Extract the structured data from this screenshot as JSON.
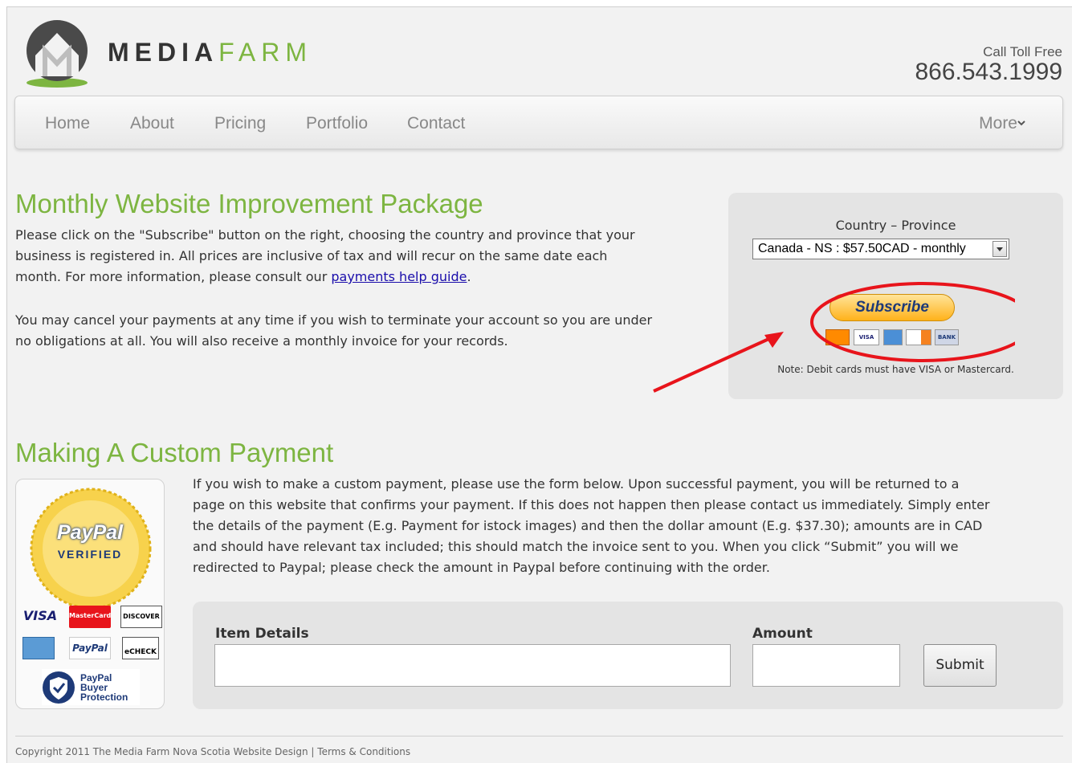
{
  "header": {
    "logo_letter": "M",
    "logo_media": "MEDIA",
    "logo_farm": "FARM",
    "call_label": "Call Toll Free",
    "phone": "866.543.1999"
  },
  "nav": {
    "items": [
      "Home",
      "About",
      "Pricing",
      "Portfolio",
      "Contact"
    ],
    "more": "More"
  },
  "monthly": {
    "title": "Monthly Website Improvement Package",
    "p1_a": "Please click on the \"Subscribe\" button on the right, choosing the country and province that your",
    "p1_b": "business is registered in. All prices are inclusive of tax and will recur on the same date each",
    "p1_c": "month. For more information, please consult our ",
    "p1_link": "payments help guide",
    "p1_end": ".",
    "p2_a": "You may cancel your payments at any time if you wish to terminate your account so you are under",
    "p2_b": "no obligations at all. You will also receive a monthly invoice for your records."
  },
  "subscribe": {
    "label": "Country – Province",
    "selected": "Canada - NS : $57.50CAD - monthly",
    "button": "Subscribe",
    "cards": [
      "VISA",
      "BANK"
    ],
    "note": "Note: Debit cards must have VISA or Mastercard."
  },
  "custom": {
    "title": "Making A Custom Payment",
    "l1": "If you wish to make a custom payment, please use the form below. Upon successful payment, you will be returned to a",
    "l2": "page on this website that confirms your payment. If this does not happen then please contact us immediately. Simply enter",
    "l3": "the details of the payment (E.g. Payment for istock images) and then the dollar amount (E.g. $37.30); amounts are in CAD",
    "l4": "and should have relevant tax included; this should match the invoice sent to you. When you click “Submit” you will we",
    "l5": "redirected to Paypal; please check the amount in Paypal before continuing with the order."
  },
  "badge": {
    "paypal": "PayPal",
    "verified": "VERIFIED",
    "visa": "VISA",
    "mastercard": "MasterCard",
    "discover": "DISCOVER",
    "paypal_small": "PayPal",
    "echeck": "eCHECK",
    "bp1": "PayPal",
    "bp2": "Buyer",
    "bp3": "Protection"
  },
  "form": {
    "item_label": "Item Details",
    "amount_label": "Amount",
    "submit": "Submit",
    "item_value": "",
    "amount_value": ""
  },
  "footer": {
    "text": "Copyright 2011 The Media Farm Nova Scotia Website Design | Terms & Conditions"
  },
  "colors": {
    "brand_green": "#7db541",
    "annotation_red": "#e8141b",
    "paypal_blue": "#1e3a78",
    "paypal_gold": "#f4c21a"
  }
}
